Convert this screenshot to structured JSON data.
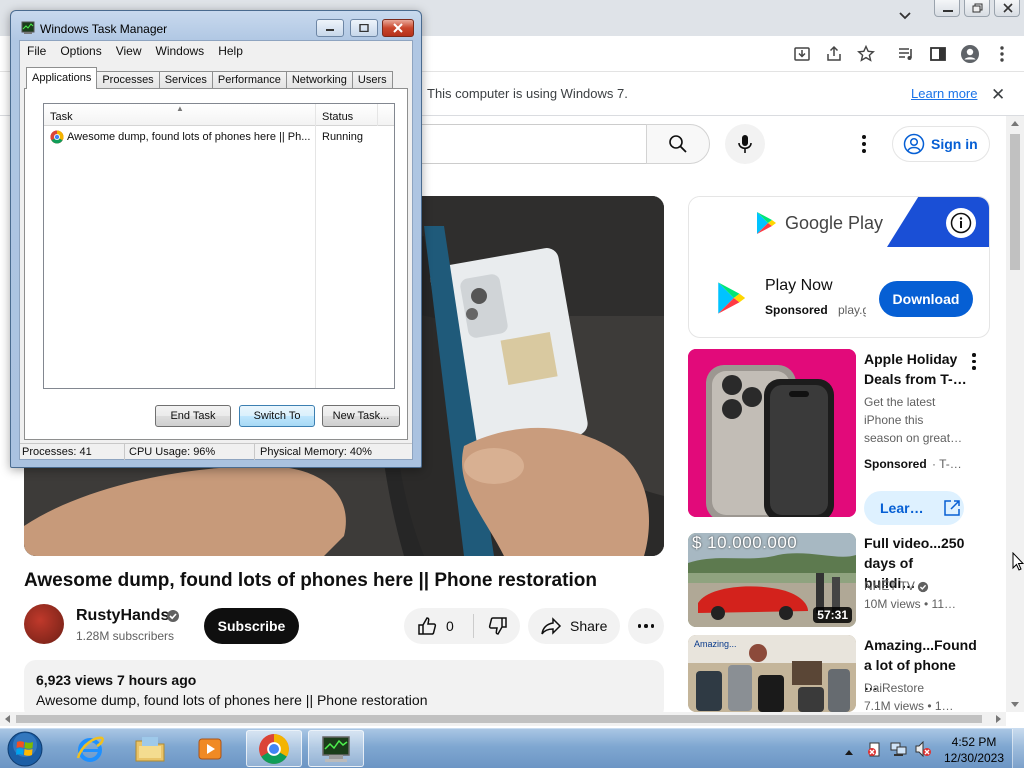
{
  "browser": {
    "infobar": {
      "message": "This computer is using Windows 7.",
      "learn_more": "Learn more"
    }
  },
  "youtube": {
    "sign_in": "Sign in",
    "video": {
      "title": "Awesome dump, found lots of phones here || Phone restoration",
      "channel": "RustyHands",
      "subscribers": "1.28M subscribers",
      "subscribe": "Subscribe",
      "likes": "0",
      "share": "Share",
      "views_time": "6,923 views  7 hours ago",
      "description": "Awesome dump, found lots of phones here || Phone restoration"
    },
    "ad": {
      "banner": "Google Play",
      "title": "Play Now",
      "sponsored": "Sponsored",
      "domain": "play.google.com",
      "cta": "Download"
    },
    "recommendations": [
      {
        "title": "Apple Holiday Deals from T-…",
        "line1": "Get the latest",
        "line2": "iPhone this",
        "line3": "season on great…",
        "sponsored": "Sponsored",
        "sponsor_suffix": "· T-…",
        "cta": "Lear…"
      },
      {
        "title": "Full video...250 days of buildi…",
        "thumb_overlay": "$ 10.000.000",
        "channel": "NHẾT TV",
        "meta": "10M views  •  11…",
        "duration": "57:31"
      },
      {
        "title": "Amazing...Found a lot of phone …",
        "thumb_overlay": "Amazing...",
        "channel": "DaiRestore",
        "meta": "7.1M views  •  1…"
      }
    ]
  },
  "taskmgr": {
    "title": "Windows Task Manager",
    "menu": [
      "File",
      "Options",
      "View",
      "Windows",
      "Help"
    ],
    "tabs": [
      "Applications",
      "Processes",
      "Services",
      "Performance",
      "Networking",
      "Users"
    ],
    "columns": {
      "task": "Task",
      "status": "Status"
    },
    "rows": [
      {
        "task": "Awesome dump, found lots of phones here || Ph...",
        "status": "Running"
      }
    ],
    "buttons": {
      "end_task": "End Task",
      "switch_to": "Switch To",
      "new_task": "New Task..."
    },
    "status": {
      "processes": "Processes: 41",
      "cpu": "CPU Usage: 96%",
      "memory": "Physical Memory: 40%"
    }
  },
  "taskbar": {
    "time": "4:52 PM",
    "date": "12/30/2023"
  }
}
